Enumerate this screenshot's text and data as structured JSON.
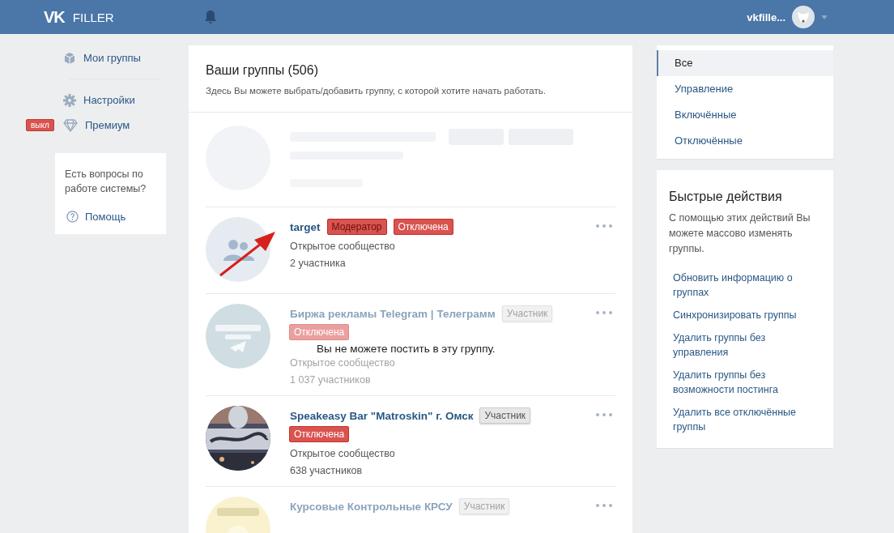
{
  "header": {
    "logo": "VK",
    "app_name": "FILLER",
    "user_name": "vkfille..."
  },
  "sidebar": {
    "items": [
      {
        "label": "Мои группы"
      },
      {
        "label": "Настройки"
      },
      {
        "label": "Премиум",
        "badge": "выкл"
      }
    ],
    "help": {
      "text": "Есть вопросы по работе системы?",
      "link": "Помощь"
    }
  },
  "main": {
    "title": "Ваши группы (506)",
    "subtitle": "Здесь Вы можете выбрать/добавить группу, с которой хотите начать работать.",
    "groups": [
      {
        "kind": "placeholder"
      },
      {
        "kind": "group",
        "name": "target",
        "disabled": false,
        "pointer": true,
        "badges": [
          {
            "label": "Модератор",
            "kind": "moderator"
          },
          {
            "label": "Отключена",
            "kind": "off"
          }
        ],
        "type_text": "Открытое сообщество",
        "members": "2 участника"
      },
      {
        "kind": "group",
        "name": "Биржа рекламы Telegram | Телеграмм",
        "disabled": true,
        "pointer": false,
        "badges": [
          {
            "label": "Участник",
            "kind": "member"
          },
          {
            "label": "Отключена",
            "kind": "off"
          }
        ],
        "type_text": "Открытое сообщество",
        "members": "1 037 участников",
        "note": "Вы не можете постить в эту группу."
      },
      {
        "kind": "group",
        "name": "Speakeasy Bar \"Matroskin\" г. Омск",
        "disabled": false,
        "pointer": false,
        "badges": [
          {
            "label": "Участник",
            "kind": "member"
          },
          {
            "label": "Отключена",
            "kind": "off"
          }
        ],
        "type_text": "Открытое сообщество",
        "members": "638 участников"
      },
      {
        "kind": "group",
        "name": "Курсовые Контрольные КРСУ",
        "disabled": true,
        "pointer": false,
        "badges": [
          {
            "label": "Участник",
            "kind": "member"
          }
        ]
      }
    ]
  },
  "filters": [
    {
      "label": "Все",
      "selected": true
    },
    {
      "label": "Управление",
      "selected": false
    },
    {
      "label": "Включённые",
      "selected": false
    },
    {
      "label": "Отключённые",
      "selected": false
    }
  ],
  "quick_actions": {
    "title": "Быстрые действия",
    "description": "С помощью этих действий Вы можете массово изменять группы.",
    "actions": [
      "Обновить информацию о группах",
      "Синхронизировать группы",
      "Удалить группы без управления",
      "Удалить группы без возможности постинга",
      "Удалить все отключённые группы"
    ]
  }
}
